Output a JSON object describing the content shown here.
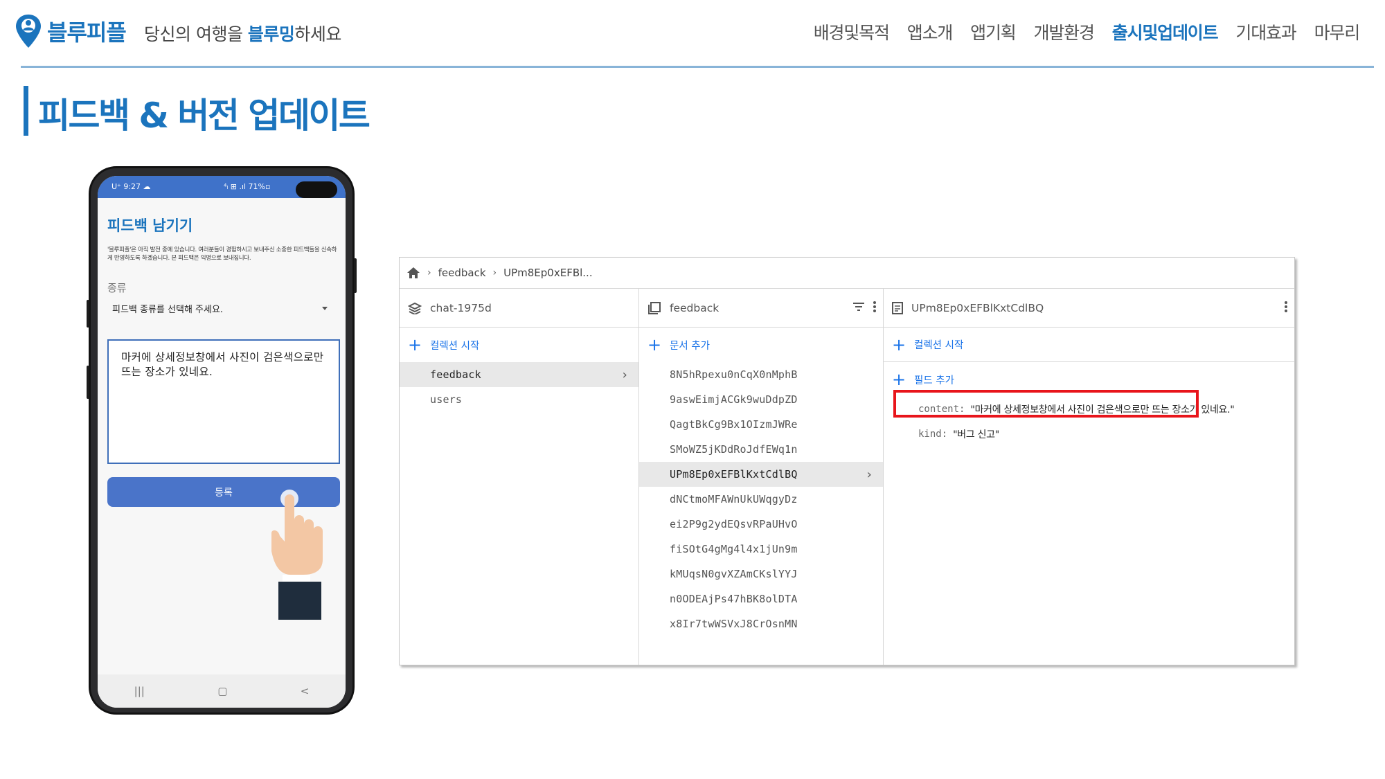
{
  "brand": {
    "name": "블루피플",
    "tagline_prefix": "당신의 여행을 ",
    "tagline_highlight": "블루밍",
    "tagline_suffix": "하세요",
    "accent_color": "#1b74bd"
  },
  "nav": {
    "items": [
      "배경및목적",
      "앱소개",
      "앱기획",
      "개발환경",
      "출시및업데이트",
      "기대효과",
      "마무리"
    ],
    "active_index": 4
  },
  "page": {
    "title": "피드백 & 버전 업데이트"
  },
  "phone": {
    "status_left": "U⁺ 9:27 ☁",
    "status_right": "⁴ₗ ⊞ .ıl 71%▫",
    "screen_title": "피드백 남기기",
    "description": "'블루피플'은 아직 발전 중에 있습니다. 여러분들이 경험하시고 보내주신 소중한 피드백들을 신속하게 반영하도록 하겠습니다. 본 피드백은 익명으로 보내집니다.",
    "kind_label": "종류",
    "kind_placeholder": "피드백 종류를 선택해 주세요.",
    "feedback_text": "마커에 상세정보창에서 사진이 검은색으로만 뜨는 장소가 있네요.",
    "submit_label": "등록",
    "nav_buttons": [
      "|||",
      "▢",
      "<"
    ]
  },
  "firestore": {
    "breadcrumb": [
      "feedback",
      "UPm8Ep0xEFBl..."
    ],
    "root": {
      "project": "chat-1975d",
      "add_label": "컬렉션 시작",
      "collections": [
        "feedback",
        "users"
      ],
      "selected_index": 0
    },
    "collection": {
      "name": "feedback",
      "add_label": "문서 추가",
      "documents": [
        "8N5hRpexu0nCqX0nMphB",
        "9aswEimjACGk9wuDdpZD",
        "QagtBkCg9Bx1OIzmJWRe",
        "SMoWZ5jKDdRoJdfEWq1n",
        "UPm8Ep0xEFBlKxtCdlBQ",
        "dNCtmoMFAWnUkUWqgyDz",
        "ei2P9g2ydEQsvRPaUHvO",
        "fiSOtG4gMg4l4x1jUn9m",
        "kMUqsN0gvXZAmCKslYYJ",
        "n0ODEAjPs47hBK8olDTA",
        "x8Ir7twWSVxJ8CrOsnMN"
      ],
      "selected_index": 4
    },
    "document": {
      "id": "UPm8Ep0xEFBlKxtCdlBQ",
      "add_collection_label": "컬렉션 시작",
      "add_field_label": "필드 추가",
      "fields": [
        {
          "key": "content:",
          "value": "\"마커에 상세정보창에서 사진이 검은색으로만 뜨는 장소가 있네요.\""
        },
        {
          "key": "kind:",
          "value": "\"버그 신고\""
        }
      ]
    }
  }
}
